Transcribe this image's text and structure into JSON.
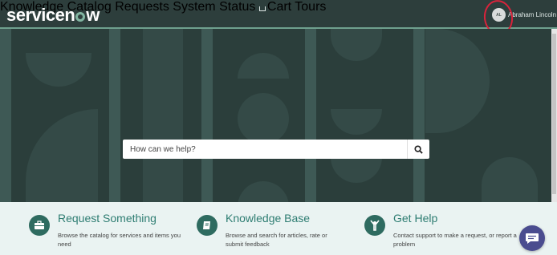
{
  "brand": {
    "logo_pre": "servicen",
    "logo_post": "w"
  },
  "nav": {
    "knowledge": "Knowledge",
    "catalog": "Catalog",
    "requests": "Requests",
    "system_status": "System Status",
    "cart": "Cart",
    "tours": "Tours"
  },
  "user": {
    "initials": "AL",
    "name": "Abraham Lincoln"
  },
  "search": {
    "placeholder": "How can we help?"
  },
  "cards": [
    {
      "title": "Request Something",
      "description": "Browse the catalog for services and items you need",
      "icon": "briefcase-icon"
    },
    {
      "title": "Knowledge Base",
      "description": "Browse and search for articles, rate or submit feedback",
      "icon": "book-icon"
    },
    {
      "title": "Get Help",
      "description": "Contact support to make a request, or report a problem",
      "icon": "help-person-icon"
    }
  ],
  "colors": {
    "header": "#2d3e3c",
    "accent": "#81b5a1",
    "card_title": "#2e7d72",
    "chat": "#4a4c8f",
    "annotation": "#d9233b"
  }
}
